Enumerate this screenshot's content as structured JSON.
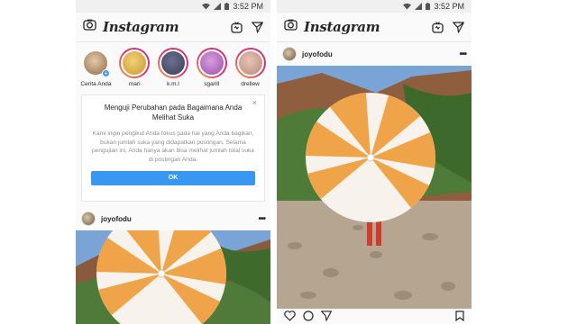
{
  "status": {
    "time": "3:52 PM"
  },
  "app": {
    "brand": "Instagram"
  },
  "stories": [
    {
      "label": "Cerita Anda",
      "own": true,
      "color": "#8a6b4a"
    },
    {
      "label": "mari",
      "own": false,
      "color": "#c59a2c"
    },
    {
      "label": "k.m.l",
      "own": false,
      "color": "#3a3f55"
    },
    {
      "label": "sgarill",
      "own": false,
      "color": "#9b4fa8"
    },
    {
      "label": "drellew",
      "own": false,
      "color": "#b58a7a"
    }
  ],
  "notice": {
    "title": "Menguji Perubahan pada Bagaimana Anda Melihat Suka",
    "body": "Kami ingin pengikut Anda fokus pada hal yang Anda bagikan, bukan jumlah suka yang didapatkan postingan. Selama pengujian ini, Anda hanya akan bisa melihat jumlah total suka di postingan Anda.",
    "close": "×",
    "ok_label": "OK"
  },
  "post": {
    "username": "joyofodu",
    "more": "•••"
  },
  "colors": {
    "accent": "#3897f0",
    "umbrella_stripe": "#f0a449",
    "umbrella_white": "#f7f3ec"
  }
}
